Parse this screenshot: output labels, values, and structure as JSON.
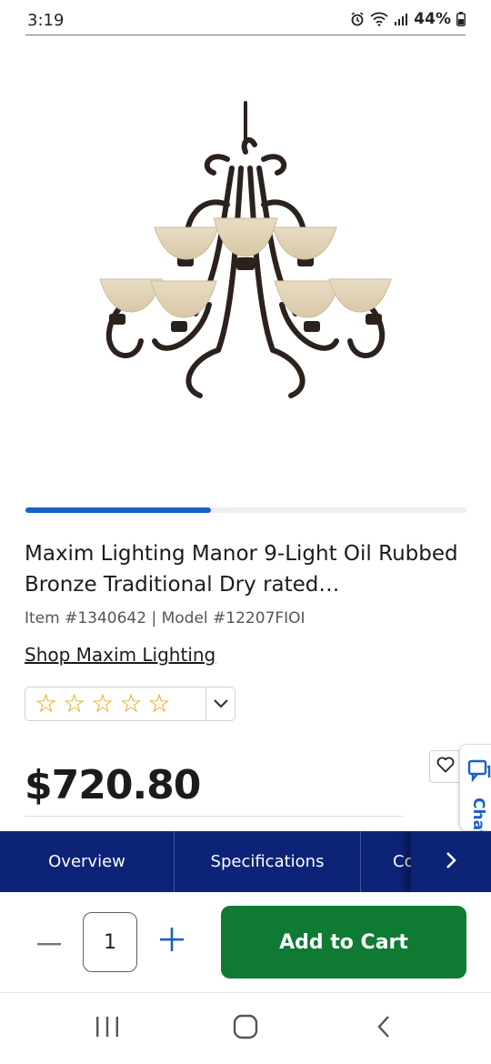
{
  "status_bar": {
    "time": "3:19",
    "battery": "44%",
    "icons": [
      "alarm-icon",
      "wifi-icon",
      "signal-icon",
      "battery-icon"
    ]
  },
  "carousel": {
    "progress": 0.42,
    "accent": "#1960c9"
  },
  "product": {
    "title": "Maxim Lighting Manor 9-Light Oil Rubbed Bronze Traditional Dry rated…",
    "item": "Item #1340642",
    "model": "Model #12207FIOI",
    "shop_link": "Shop Maxim Lighting",
    "rating_stars": 0,
    "price": "$720.80"
  },
  "chat_tab": {
    "label": "Chat"
  },
  "tabs": [
    {
      "label": "Overview"
    },
    {
      "label": "Specifications"
    },
    {
      "label": "Co"
    }
  ],
  "bottom_bar": {
    "quantity": "1",
    "add_to_cart": "Add to Cart",
    "button_color": "#0f7a33"
  },
  "colors": {
    "nav_blue": "#0c2377",
    "star": "#e0a100"
  }
}
